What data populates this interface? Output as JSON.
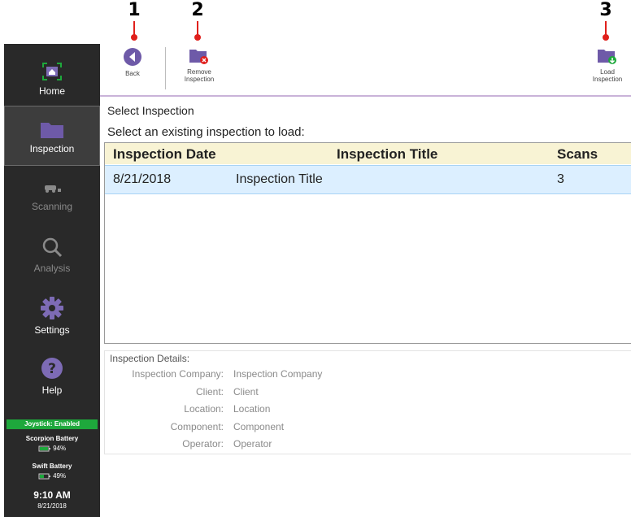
{
  "callouts": [
    "1",
    "2",
    "3"
  ],
  "sidebar": {
    "items": [
      {
        "label": "Home",
        "icon": "home-icon"
      },
      {
        "label": "Inspection",
        "icon": "folder-icon"
      },
      {
        "label": "Scanning",
        "icon": "scanner-icon"
      },
      {
        "label": "Analysis",
        "icon": "magnifier-icon"
      },
      {
        "label": "Settings",
        "icon": "gear-icon"
      },
      {
        "label": "Help",
        "icon": "question-icon"
      }
    ],
    "joystick": "Joystick: Enabled",
    "scorpion_label": "Scorpion Battery",
    "scorpion_value": "94%",
    "swift_label": "Swift Battery",
    "swift_value": "49%",
    "time": "9:10 AM",
    "date": "8/21/2018"
  },
  "toolbar": {
    "back": "Back",
    "remove_line1": "Remove",
    "remove_line2": "Inspection",
    "load_line1": "Load",
    "load_line2": "Inspection"
  },
  "main": {
    "title": "Select Inspection",
    "prompt": "Select an existing inspection to load:",
    "columns": [
      "Inspection Date",
      "Inspection Title",
      "Scans"
    ],
    "rows": [
      {
        "date": "8/21/2018",
        "title": "Inspection Title",
        "scans": "3"
      }
    ]
  },
  "details": {
    "heading": "Inspection Details:",
    "fields": [
      {
        "label": "Inspection Company:",
        "value": "Inspection Company"
      },
      {
        "label": "Client:",
        "value": "Client"
      },
      {
        "label": "Location:",
        "value": "Location"
      },
      {
        "label": "Component:",
        "value": "Component"
      },
      {
        "label": "Operator:",
        "value": "Operator"
      }
    ]
  },
  "colors": {
    "sidebar_bg": "#292929",
    "accent_purple": "#6e5aa8",
    "callout_red": "#e0201c",
    "joystick_green": "#1ea83c",
    "header_bg": "#f8f3d4",
    "row_selected": "#dcefff"
  }
}
